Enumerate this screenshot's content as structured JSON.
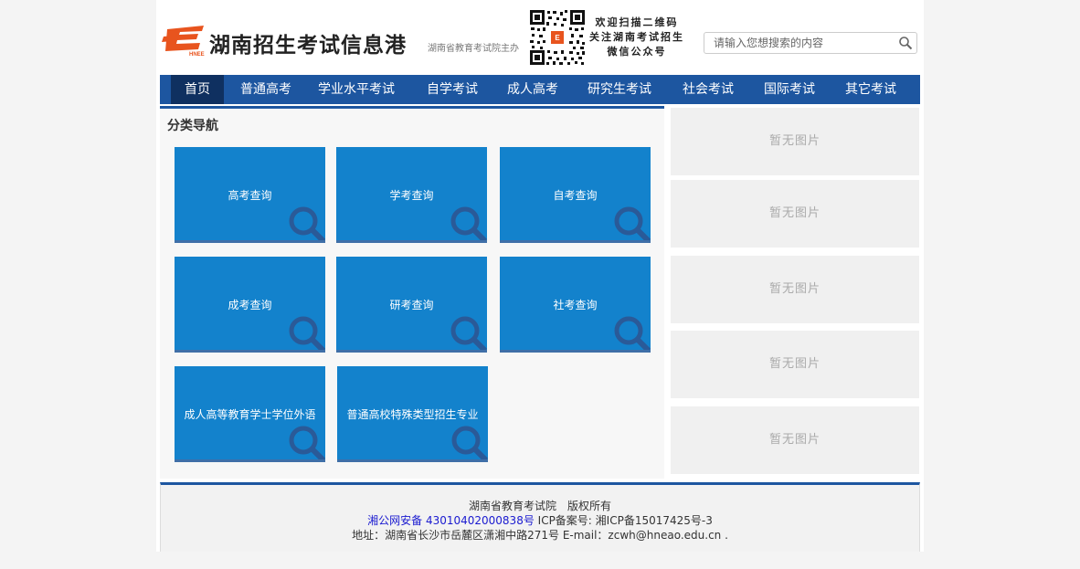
{
  "header": {
    "logo_icon": "hneea-logo-icon",
    "site_title": "湖南招生考试信息港",
    "sponsor": "湖南省教育考试院主办",
    "qr_icon": "wechat-qr-code-icon",
    "qr_lines": [
      "欢迎扫描二维码",
      "关注湖南考试招生",
      "微信公众号"
    ],
    "search_placeholder": "请输入您想搜索的内容",
    "search_icon": "search-icon"
  },
  "nav": {
    "items": [
      {
        "label": "首页",
        "active": true
      },
      {
        "label": "普通高考"
      },
      {
        "label": "学业水平考试"
      },
      {
        "label": "自学考试"
      },
      {
        "label": "成人高考"
      },
      {
        "label": "研究生考试"
      },
      {
        "label": "社会考试"
      },
      {
        "label": "国际考试"
      },
      {
        "label": "其它考试"
      }
    ]
  },
  "category_nav": {
    "title": "分类导航",
    "tiles": [
      {
        "label": "高考查询"
      },
      {
        "label": "学考查询"
      },
      {
        "label": "自考查询"
      },
      {
        "label": "成考查询"
      },
      {
        "label": "研考查询"
      },
      {
        "label": "社考查询"
      },
      {
        "label": "成人高等教育学士学位外语"
      },
      {
        "label": "普通高校特殊类型招生专业"
      }
    ]
  },
  "side_images": [
    {
      "label": "暂无图片"
    },
    {
      "label": "暂无图片"
    },
    {
      "label": "暂无图片"
    },
    {
      "label": "暂无图片"
    },
    {
      "label": "暂无图片"
    }
  ],
  "footer": {
    "copyright": "湖南省教育考试院　版权所有",
    "police_record": "湘公网安备 43010402000838号",
    "icp": "ICP备案号: 湘ICP备15017425号-3",
    "address": "地址：湖南省长沙市岳麓区潇湘中路271号 E-mail：zcwh@hneao.edu.cn ."
  },
  "colors": {
    "nav_bg": "#1d56a0",
    "nav_active": "#0f3060",
    "tile_bg": "#1382cc",
    "logo_orange": "#e8541e"
  }
}
